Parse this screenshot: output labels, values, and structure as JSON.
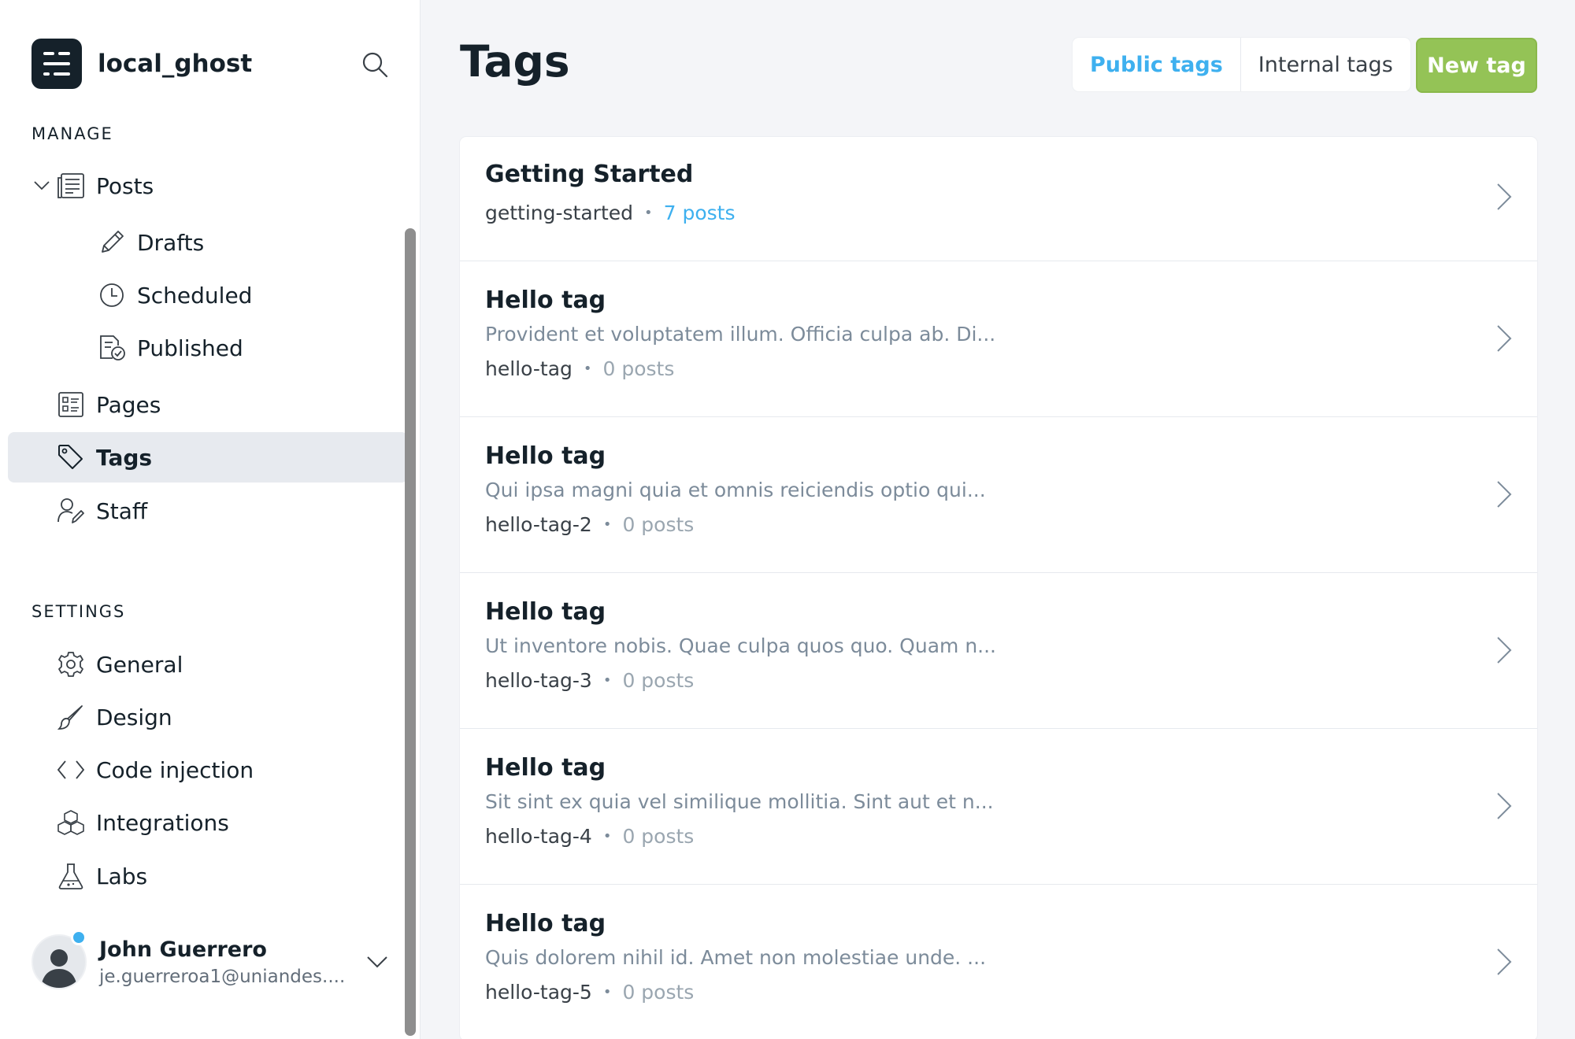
{
  "app": {
    "name": "local_ghost"
  },
  "sidebar": {
    "manage_title": "MANAGE",
    "settings_title": "SETTINGS",
    "posts_label": "Posts",
    "drafts_label": "Drafts",
    "scheduled_label": "Scheduled",
    "published_label": "Published",
    "pages_label": "Pages",
    "tags_label": "Tags",
    "staff_label": "Staff",
    "general_label": "General",
    "design_label": "Design",
    "code_injection_label": "Code injection",
    "integrations_label": "Integrations",
    "labs_label": "Labs"
  },
  "user": {
    "name": "John Guerrero",
    "email": "je.guerreroa1@uniandes...."
  },
  "header": {
    "title": "Tags",
    "tabs": [
      "Public tags",
      "Internal tags"
    ],
    "active_tab": "Public tags",
    "new_tag_label": "New tag"
  },
  "tags": [
    {
      "name": "Getting Started",
      "description": "",
      "slug": "getting-started",
      "count": "7 posts"
    },
    {
      "name": "Hello tag",
      "description": "Provident et voluptatem illum. Officia culpa ab. Di...",
      "slug": "hello-tag",
      "count": "0 posts"
    },
    {
      "name": "Hello tag",
      "description": "Qui ipsa magni quia et omnis reiciendis optio qui...",
      "slug": "hello-tag-2",
      "count": "0 posts"
    },
    {
      "name": "Hello tag",
      "description": "Ut inventore nobis. Quae culpa quos quo. Quam n...",
      "slug": "hello-tag-3",
      "count": "0 posts"
    },
    {
      "name": "Hello tag",
      "description": "Sit sint ex quia vel similique mollitia. Sint aut et n...",
      "slug": "hello-tag-4",
      "count": "0 posts"
    },
    {
      "name": "Hello tag",
      "description": "Quis dolorem nihil id. Amet non molestiae unde. ...",
      "slug": "hello-tag-5",
      "count": "0 posts"
    }
  ],
  "meta_separator": "•",
  "colors": {
    "accent": "#3eb0ef",
    "primary_button": "#94c356",
    "text": "#15212a",
    "muted": "#7c8b9a"
  }
}
